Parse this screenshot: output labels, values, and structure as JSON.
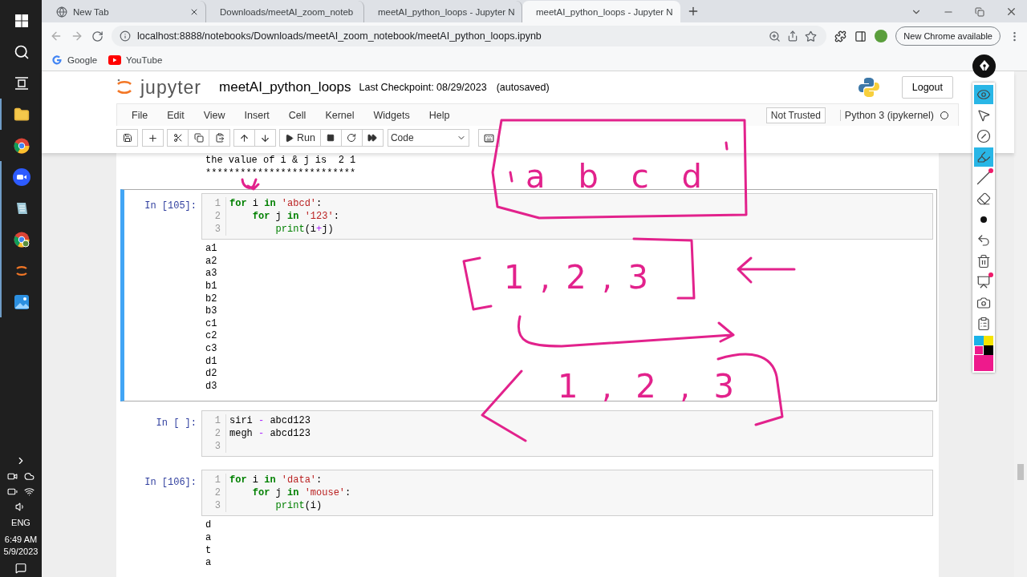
{
  "taskbar": {
    "items": [
      {
        "kind": "start",
        "running": false
      },
      {
        "kind": "search",
        "running": false
      },
      {
        "kind": "taskview",
        "running": false
      },
      {
        "kind": "folder",
        "running": true
      },
      {
        "kind": "chrome",
        "running": false
      },
      {
        "kind": "zoom",
        "running": true
      },
      {
        "kind": "notes",
        "running": true
      },
      {
        "kind": "chrome-profile",
        "running": true
      },
      {
        "kind": "loader",
        "running": true
      },
      {
        "kind": "photos",
        "running": true
      }
    ],
    "language": "ENG",
    "time": "6:49 AM",
    "date": "5/9/2023"
  },
  "browser": {
    "tabs": [
      {
        "kind": "globe",
        "title": "New Tab",
        "selected": false
      },
      {
        "kind": "loader",
        "title": "Downloads/meetAI_zoom_noteb",
        "selected": false
      },
      {
        "kind": "book",
        "title": "meetAI_python_loops - Jupyter N",
        "selected": false
      },
      {
        "kind": "book",
        "title": "meetAI_python_loops - Jupyter N",
        "selected": true
      }
    ],
    "url": "localhost:8888/notebooks/Downloads/meetAI_zoom_notebook/meetAI_python_loops.ipynb",
    "update_button": "New Chrome available",
    "bookmarks": [
      {
        "kind": "google",
        "label": "Google"
      },
      {
        "kind": "youtube",
        "label": "YouTube"
      }
    ]
  },
  "jupyter": {
    "logo_text": "jupyter",
    "notebook_name": "meetAI_python_loops",
    "checkpoint": "Last Checkpoint: 08/29/2023",
    "autosave": "(autosaved)",
    "logout": "Logout",
    "menu": [
      "File",
      "Edit",
      "View",
      "Insert",
      "Cell",
      "Kernel",
      "Widgets",
      "Help"
    ],
    "trust": "Not Trusted",
    "kernel": "Python 3 (ipykernel)",
    "kernel_busy": false,
    "run_label": "Run",
    "cell_type": "Code"
  },
  "leading_output": [
    "the value of i & j is  2 1",
    "**************************"
  ],
  "cells": [
    {
      "prompt": "In [105]:",
      "selected": true,
      "lines": [
        {
          "number": "1",
          "tokens": [
            {
              "text": "for",
              "kind": "keyword"
            },
            {
              "text": " i ",
              "kind": "plain"
            },
            {
              "text": "in",
              "kind": "keyword"
            },
            {
              "text": " 'abcd'",
              "kind": "string"
            },
            {
              "text": ":",
              "kind": "plain"
            }
          ]
        },
        {
          "number": "2",
          "tokens": [
            {
              "text": "    for",
              "kind": "keyword"
            },
            {
              "text": " j ",
              "kind": "plain"
            },
            {
              "text": "in",
              "kind": "keyword"
            },
            {
              "text": " '123'",
              "kind": "string"
            },
            {
              "text": ":",
              "kind": "plain"
            }
          ]
        },
        {
          "number": "3",
          "tokens": [
            {
              "text": "        print",
              "kind": "builtin"
            },
            {
              "text": "(i",
              "kind": "plain"
            },
            {
              "text": "+",
              "kind": "operator"
            },
            {
              "text": "j)",
              "kind": "plain"
            }
          ]
        }
      ],
      "output": [
        "a1",
        "a2",
        "a3",
        "b1",
        "b2",
        "b3",
        "c1",
        "c2",
        "c3",
        "d1",
        "d2",
        "d3"
      ]
    },
    {
      "prompt": "In [ ]:",
      "selected": false,
      "lines": [
        {
          "number": "1",
          "tokens": [
            {
              "text": "siri ",
              "kind": "plain"
            },
            {
              "text": "-",
              "kind": "operator"
            },
            {
              "text": " abcd123",
              "kind": "plain"
            }
          ]
        },
        {
          "number": "2",
          "tokens": [
            {
              "text": "megh ",
              "kind": "plain"
            },
            {
              "text": "-",
              "kind": "operator"
            },
            {
              "text": " abcd123",
              "kind": "plain"
            }
          ]
        },
        {
          "number": "3"
        }
      ]
    },
    {
      "prompt": "In [106]:",
      "selected": false,
      "lines": [
        {
          "number": "1",
          "tokens": [
            {
              "text": "for",
              "kind": "keyword"
            },
            {
              "text": " i ",
              "kind": "plain"
            },
            {
              "text": "in",
              "kind": "keyword"
            },
            {
              "text": " 'data'",
              "kind": "string"
            },
            {
              "text": ":",
              "kind": "plain"
            }
          ]
        },
        {
          "number": "2",
          "tokens": [
            {
              "text": "    for",
              "kind": "keyword"
            },
            {
              "text": " j ",
              "kind": "plain"
            },
            {
              "text": "in",
              "kind": "keyword"
            },
            {
              "text": " 'mouse'",
              "kind": "string"
            },
            {
              "text": ":",
              "kind": "plain"
            }
          ]
        },
        {
          "number": "3",
          "tokens": [
            {
              "text": "        print",
              "kind": "builtin"
            },
            {
              "text": "(i)",
              "kind": "plain"
            }
          ]
        }
      ],
      "output": [
        "d",
        "a",
        "t",
        "a"
      ]
    }
  ],
  "pen_toolbar": {
    "tools": [
      {
        "kind": "eye",
        "selected": true,
        "marked": false
      },
      {
        "kind": "pointer",
        "selected": false,
        "marked": false
      },
      {
        "kind": "no-draw",
        "selected": false,
        "marked": false
      },
      {
        "kind": "highlighter",
        "selected": true,
        "marked": false
      },
      {
        "kind": "line",
        "selected": false,
        "marked": true
      },
      {
        "kind": "eraser",
        "selected": false,
        "marked": false
      },
      {
        "kind": "dot",
        "selected": false,
        "marked": false
      },
      {
        "kind": "undo",
        "selected": false,
        "marked": false
      },
      {
        "kind": "trash",
        "selected": false,
        "marked": false
      },
      {
        "kind": "easel",
        "selected": false,
        "marked": true
      },
      {
        "kind": "camera",
        "selected": false,
        "marked": false
      },
      {
        "kind": "clipboard",
        "selected": false,
        "marked": false
      }
    ],
    "colors": [
      {
        "color": "#1ab2e8",
        "selected": false
      },
      {
        "color": "#f5e400",
        "selected": false
      },
      {
        "color": "#ee1a8c",
        "selected": true
      },
      {
        "color": "#000000",
        "selected": false
      }
    ]
  },
  "ink_notes": [
    "a  b  c  d",
    "1 ,  2  ,  3",
    "1 ,   2 ,   3"
  ]
}
